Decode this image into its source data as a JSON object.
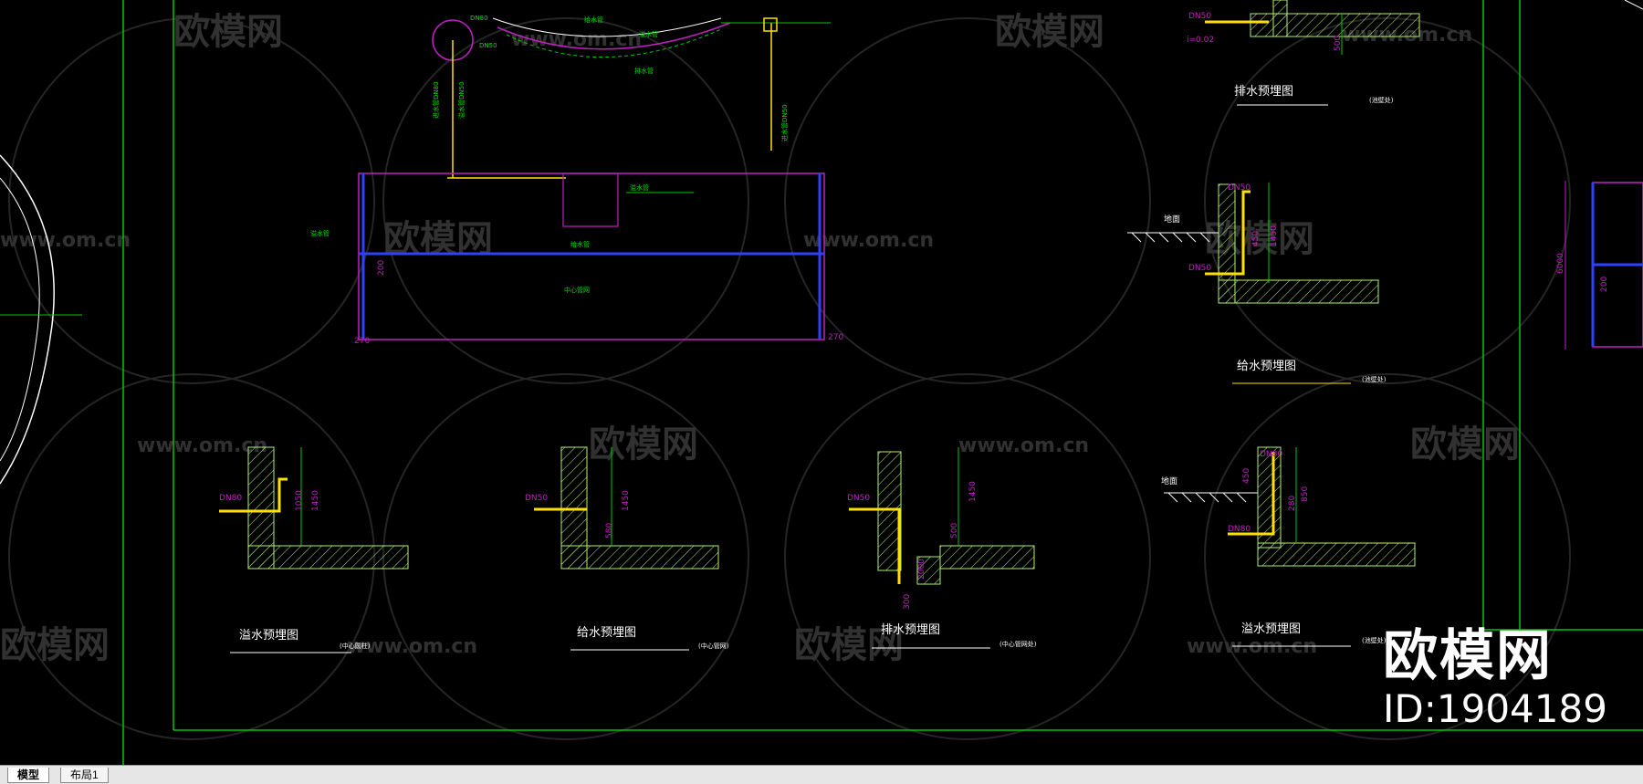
{
  "tabs": [
    {
      "label": "模型",
      "active": true
    },
    {
      "label": "布局1",
      "active": false
    }
  ],
  "corner_watermark": {
    "logo": "欧模网",
    "id_label": "ID:1904189"
  },
  "watermark": {
    "brand": "欧模网",
    "site": "www.om.cn"
  },
  "colors": {
    "background": "#000000",
    "green": "#00d200",
    "magenta": "#c020c0",
    "yellow": "#ffe000",
    "white": "#ffffff",
    "hatch": "#a8f060"
  },
  "drawing": {
    "top_labels": [
      "DN80",
      "DN50",
      "溢水管",
      "进水管DN80",
      "溢水管DN50",
      "进水管DN50",
      "排水管",
      "给水管",
      "溢水管"
    ],
    "top_plan": {
      "labels": [
        "溢水管",
        "给水管",
        "中心管网"
      ],
      "dims": [
        "200",
        "270",
        "270"
      ]
    },
    "top_right_detail": {
      "labels": [
        "DN50",
        "i=0.02"
      ],
      "dim": "500",
      "title": "排水预埋图",
      "note": "(池壁处)"
    },
    "right_mid_detail": {
      "labels": [
        "DN50",
        "DN50",
        "地面"
      ],
      "dims": [
        "450",
        "1450"
      ],
      "title": "给水预埋图",
      "note": "(池壁处)"
    },
    "far_right": {
      "dims": [
        "6000",
        "200"
      ]
    },
    "details": [
      {
        "pipe": "DN80",
        "dims": [
          "1050",
          "1450"
        ],
        "title": "溢水预埋图",
        "note": "(中心圆柱)"
      },
      {
        "pipe": "DN50",
        "dims": [
          "580",
          "1450"
        ],
        "title": "给水预埋图",
        "note": "(中心管网)"
      },
      {
        "pipe": "DN50",
        "dims": [
          "500",
          "1450",
          "2000",
          "300"
        ],
        "title": "排水预埋图",
        "note": "(中心管网处)"
      },
      {
        "pipe": "DN80",
        "dims": [
          "450",
          "850",
          "280"
        ],
        "title": "溢水预埋图",
        "note": "(池壁处)",
        "extra": [
          "DN80",
          "地面"
        ]
      }
    ]
  }
}
